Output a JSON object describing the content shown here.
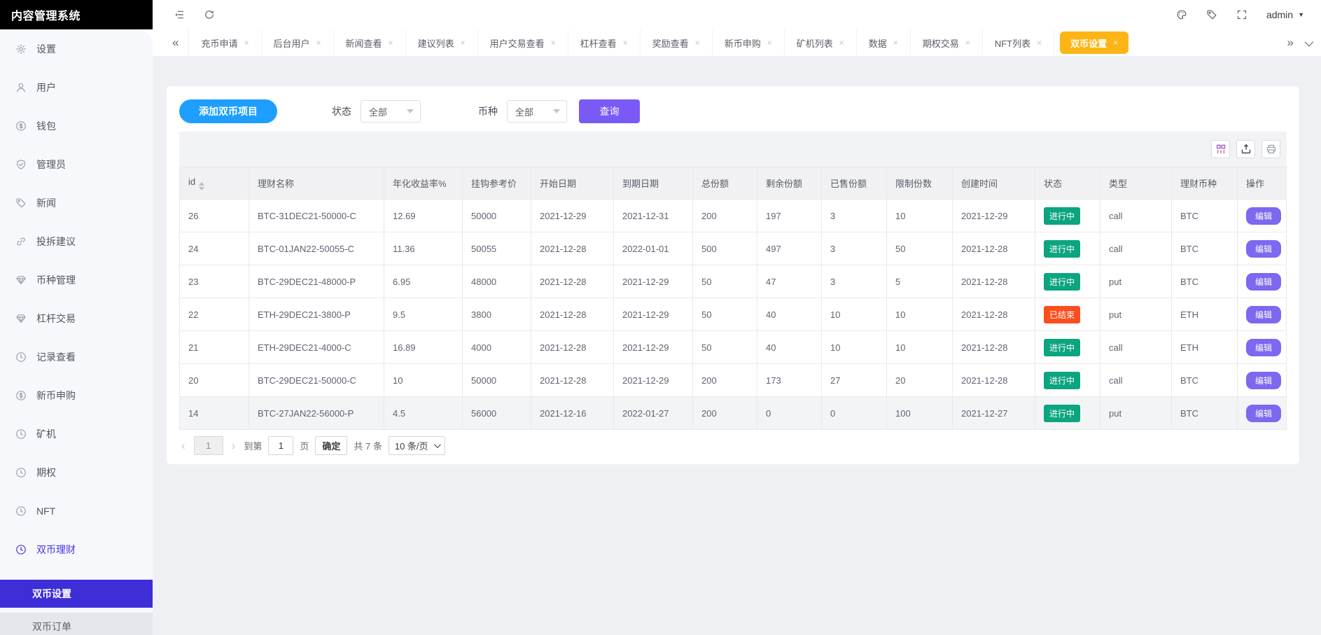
{
  "app": {
    "title": "内容管理系统"
  },
  "topbar": {
    "user": "admin"
  },
  "icons": {
    "chevrons_left": "«",
    "chevrons_right": "»",
    "close": "×",
    "caret_down": "▼",
    "prev": "‹",
    "next": "›"
  },
  "sidebar": {
    "items": [
      {
        "label": "设置",
        "icon": "gear-icon",
        "state": ""
      },
      {
        "label": "用户",
        "icon": "user-icon",
        "state": ""
      },
      {
        "label": "钱包",
        "icon": "dollar-circle-icon",
        "state": ""
      },
      {
        "label": "管理员",
        "icon": "shield-check-icon",
        "state": ""
      },
      {
        "label": "新闻",
        "icon": "tag-icon",
        "state": ""
      },
      {
        "label": "投拆建议",
        "icon": "link-icon",
        "state": ""
      },
      {
        "label": "币种管理",
        "icon": "gem-icon",
        "state": ""
      },
      {
        "label": "杠杆交易",
        "icon": "gem-icon",
        "state": ""
      },
      {
        "label": "记录查看",
        "icon": "clock-icon",
        "state": ""
      },
      {
        "label": "新币申购",
        "icon": "dollar-circle-icon",
        "state": ""
      },
      {
        "label": "矿机",
        "icon": "clock-icon",
        "state": ""
      },
      {
        "label": "期权",
        "icon": "clock-icon",
        "state": ""
      },
      {
        "label": "NFT",
        "icon": "clock-icon",
        "state": ""
      },
      {
        "label": "双币理财",
        "icon": "clock-icon",
        "state": "active"
      }
    ],
    "subitems": [
      {
        "label": "双币设置",
        "state": "active"
      },
      {
        "label": "双币订单",
        "state": ""
      }
    ]
  },
  "tabs": [
    {
      "label": "充币申请",
      "state": ""
    },
    {
      "label": "后台用户",
      "state": ""
    },
    {
      "label": "新闻查看",
      "state": ""
    },
    {
      "label": "建议列表",
      "state": ""
    },
    {
      "label": "用户交易查看",
      "state": ""
    },
    {
      "label": "杠杆查看",
      "state": ""
    },
    {
      "label": "奖励查看",
      "state": ""
    },
    {
      "label": "新币申购",
      "state": ""
    },
    {
      "label": "矿机列表",
      "state": ""
    },
    {
      "label": "数据",
      "state": ""
    },
    {
      "label": "期权交易",
      "state": ""
    },
    {
      "label": "NFT列表",
      "state": ""
    },
    {
      "label": "双币设置",
      "state": "active"
    }
  ],
  "filters": {
    "add_button": "添加双币项目",
    "status_label": "状态",
    "status_value": "全部",
    "coin_label": "币种",
    "coin_value": "全部",
    "search_button": "查询"
  },
  "toolbar_icons": [
    "columns-icon",
    "export-icon",
    "print-icon"
  ],
  "table": {
    "columns": [
      {
        "label": "id",
        "sort": "show"
      },
      {
        "label": "理财名称",
        "sort": ""
      },
      {
        "label": "年化收益率%",
        "sort": ""
      },
      {
        "label": "挂钩参考价",
        "sort": ""
      },
      {
        "label": "开始日期",
        "sort": ""
      },
      {
        "label": "到期日期",
        "sort": ""
      },
      {
        "label": "总份额",
        "sort": ""
      },
      {
        "label": "剩余份额",
        "sort": ""
      },
      {
        "label": "已售份额",
        "sort": ""
      },
      {
        "label": "限制份数",
        "sort": ""
      },
      {
        "label": "创建时间",
        "sort": ""
      },
      {
        "label": "状态",
        "sort": ""
      },
      {
        "label": "类型",
        "sort": ""
      },
      {
        "label": "理财币种",
        "sort": ""
      },
      {
        "label": "操作",
        "sort": ""
      }
    ],
    "rows": [
      {
        "id": "26",
        "name": "BTC-31DEC21-50000-C",
        "rate": "12.69",
        "ref_price": "50000",
        "start": "2021-12-29",
        "end": "2021-12-31",
        "total": "200",
        "remaining": "197",
        "sold": "3",
        "limit": "10",
        "created": "2021-12-29",
        "status": {
          "label": "进行中",
          "state": "ongoing"
        },
        "type": "call",
        "coin": "BTC",
        "row_class": ""
      },
      {
        "id": "24",
        "name": "BTC-01JAN22-50055-C",
        "rate": "11.36",
        "ref_price": "50055",
        "start": "2021-12-28",
        "end": "2022-01-01",
        "total": "500",
        "remaining": "497",
        "sold": "3",
        "limit": "50",
        "created": "2021-12-28",
        "status": {
          "label": "进行中",
          "state": "ongoing"
        },
        "type": "call",
        "coin": "BTC",
        "row_class": ""
      },
      {
        "id": "23",
        "name": "BTC-29DEC21-48000-P",
        "rate": "6.95",
        "ref_price": "48000",
        "start": "2021-12-28",
        "end": "2021-12-29",
        "total": "50",
        "remaining": "47",
        "sold": "3",
        "limit": "5",
        "created": "2021-12-28",
        "status": {
          "label": "进行中",
          "state": "ongoing"
        },
        "type": "put",
        "coin": "BTC",
        "row_class": ""
      },
      {
        "id": "22",
        "name": "ETH-29DEC21-3800-P",
        "rate": "9.5",
        "ref_price": "3800",
        "start": "2021-12-28",
        "end": "2021-12-29",
        "total": "50",
        "remaining": "40",
        "sold": "10",
        "limit": "10",
        "created": "2021-12-28",
        "status": {
          "label": "已结束",
          "state": "ended"
        },
        "type": "put",
        "coin": "ETH",
        "row_class": ""
      },
      {
        "id": "21",
        "name": "ETH-29DEC21-4000-C",
        "rate": "16.89",
        "ref_price": "4000",
        "start": "2021-12-28",
        "end": "2021-12-29",
        "total": "50",
        "remaining": "40",
        "sold": "10",
        "limit": "10",
        "created": "2021-12-28",
        "status": {
          "label": "进行中",
          "state": "ongoing"
        },
        "type": "call",
        "coin": "ETH",
        "row_class": ""
      },
      {
        "id": "20",
        "name": "BTC-29DEC21-50000-C",
        "rate": "10",
        "ref_price": "50000",
        "start": "2021-12-28",
        "end": "2021-12-29",
        "total": "200",
        "remaining": "173",
        "sold": "27",
        "limit": "20",
        "created": "2021-12-28",
        "status": {
          "label": "进行中",
          "state": "ongoing"
        },
        "type": "call",
        "coin": "BTC",
        "row_class": ""
      },
      {
        "id": "14",
        "name": "BTC-27JAN22-56000-P",
        "rate": "4.5",
        "ref_price": "56000",
        "start": "2021-12-16",
        "end": "2022-01-27",
        "total": "200",
        "remaining": "0",
        "sold": "0",
        "limit": "100",
        "created": "2021-12-27",
        "status": {
          "label": "进行中",
          "state": "ongoing"
        },
        "type": "put",
        "coin": "BTC",
        "row_class": "shaded"
      }
    ]
  },
  "actions": {
    "edit_label": "编辑"
  },
  "pagination": {
    "current_page": "1",
    "goto_label": "到第",
    "goto_value": "1",
    "page_unit_label": "页",
    "confirm_label": "确定",
    "total_label": "共 7 条",
    "page_size": "10 条/页"
  },
  "colors": {
    "active_tab": "#fdb515",
    "primary_blue": "#1e9fff",
    "search_purple": "#7a5af5",
    "edit_purple": "#7d68f0",
    "status_ongoing": "#0ca57f",
    "status_ended": "#fb4e1e",
    "submenu_active": "#3e2ed8"
  }
}
